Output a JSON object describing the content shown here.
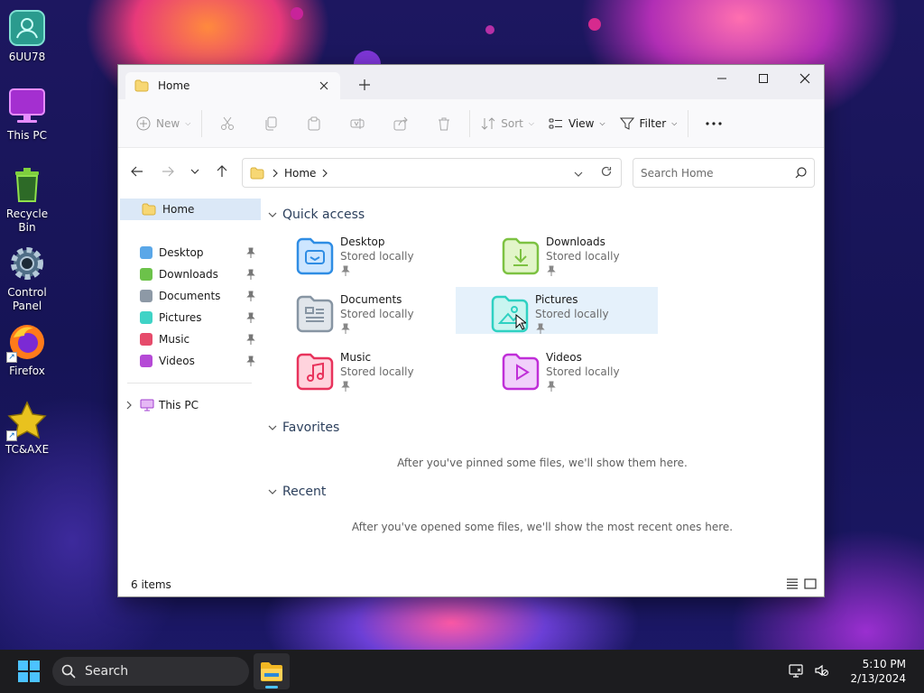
{
  "desktop": {
    "icons": [
      {
        "label": "6UU78"
      },
      {
        "label": "This PC"
      },
      {
        "label": "Recycle Bin"
      },
      {
        "label": "Control Panel"
      },
      {
        "label": "Firefox"
      },
      {
        "label": "TC&AXE"
      }
    ]
  },
  "window": {
    "tab_label": "Home",
    "toolbar": {
      "new_label": "New",
      "sort_label": "Sort",
      "view_label": "View",
      "filter_label": "Filter"
    },
    "address": {
      "crumb": "Home",
      "search_placeholder": "Search Home"
    },
    "sidebar": {
      "home": "Home",
      "pinned": [
        {
          "label": "Desktop",
          "color": "#5aa7e8"
        },
        {
          "label": "Downloads",
          "color": "#6cc24a"
        },
        {
          "label": "Documents",
          "color": "#8d99a6"
        },
        {
          "label": "Pictures",
          "color": "#3fd3c6"
        },
        {
          "label": "Music",
          "color": "#e64b6b"
        },
        {
          "label": "Videos",
          "color": "#b54ad6"
        }
      ],
      "this_pc": "This PC"
    },
    "quick_access": {
      "title": "Quick access",
      "items": [
        {
          "name": "Desktop",
          "sub": "Stored locally",
          "color": "#2f8de4"
        },
        {
          "name": "Downloads",
          "sub": "Stored locally",
          "color": "#7dc242"
        },
        {
          "name": "Documents",
          "sub": "Stored locally",
          "color": "#8795a3"
        },
        {
          "name": "Pictures",
          "sub": "Stored locally",
          "color": "#2fd1c2"
        },
        {
          "name": "Music",
          "sub": "Stored locally",
          "color": "#e8335c"
        },
        {
          "name": "Videos",
          "sub": "Stored locally",
          "color": "#c02fd8"
        }
      ]
    },
    "favorites": {
      "title": "Favorites",
      "empty": "After you've pinned some files, we'll show them here."
    },
    "recent": {
      "title": "Recent",
      "empty": "After you've opened some files, we'll show the most recent ones here."
    },
    "status": {
      "count": "6 items"
    }
  },
  "taskbar": {
    "search_label": "Search",
    "time": "5:10 PM",
    "date": "2/13/2024"
  }
}
